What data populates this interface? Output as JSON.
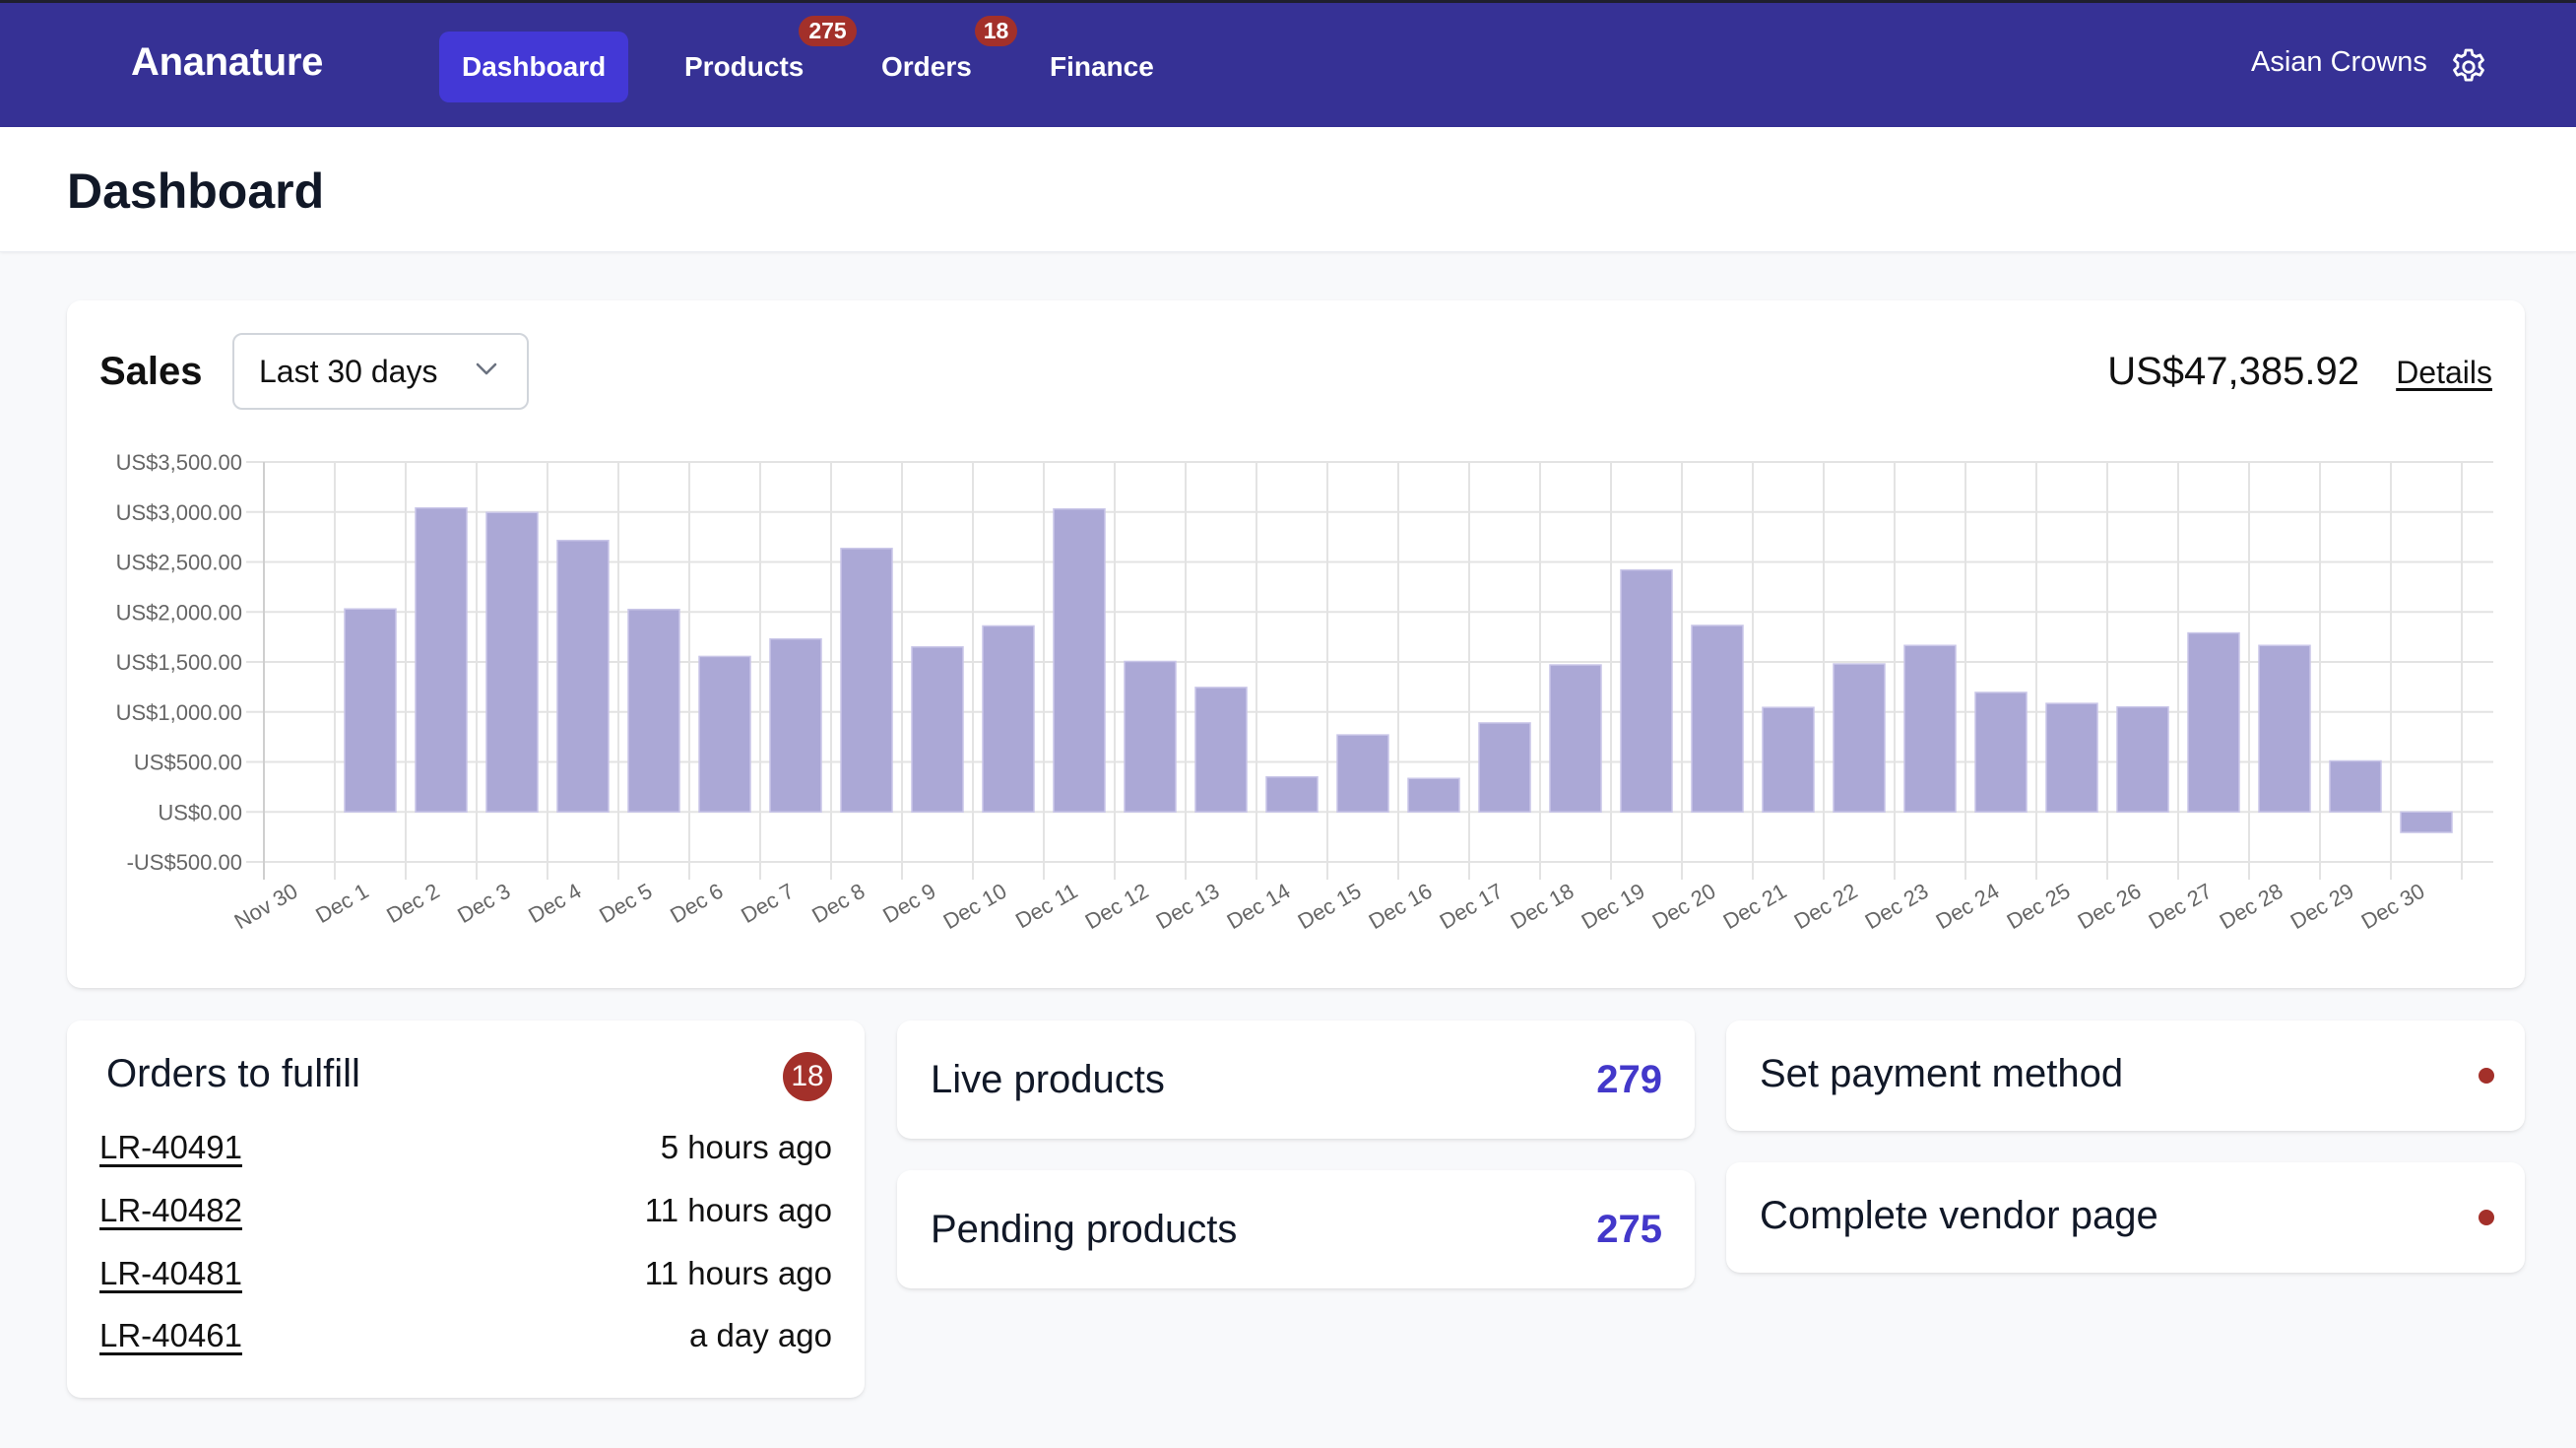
{
  "header": {
    "logo": "Ananature",
    "nav": [
      {
        "label": "Dashboard",
        "active": true
      },
      {
        "label": "Products",
        "badge": "275"
      },
      {
        "label": "Orders",
        "badge": "18"
      },
      {
        "label": "Finance"
      }
    ],
    "account_name": "Asian Crowns",
    "settings_icon": "gear-icon"
  },
  "page": {
    "title": "Dashboard"
  },
  "sales": {
    "label": "Sales",
    "range": "Last 30 days",
    "total": "US$47,385.92",
    "details_label": "Details"
  },
  "chart_data": {
    "type": "bar",
    "title": "Sales",
    "xlabel": "",
    "ylabel": "",
    "ylim": [
      -500,
      3500
    ],
    "yticks": [
      -500,
      0,
      500,
      1000,
      1500,
      2000,
      2500,
      3000,
      3500
    ],
    "ytick_labels": [
      "-US$500.00",
      "US$0.00",
      "US$500.00",
      "US$1,000.00",
      "US$1,500.00",
      "US$2,000.00",
      "US$2,500.00",
      "US$3,000.00",
      "US$3,500.00"
    ],
    "grid": true,
    "legend": "none",
    "bar_color": "#aba8d6",
    "categories": [
      "Nov 30",
      "Dec 1",
      "Dec 2",
      "Dec 3",
      "Dec 4",
      "Dec 5",
      "Dec 6",
      "Dec 7",
      "Dec 8",
      "Dec 9",
      "Dec 10",
      "Dec 11",
      "Dec 12",
      "Dec 13",
      "Dec 14",
      "Dec 15",
      "Dec 16",
      "Dec 17",
      "Dec 18",
      "Dec 19",
      "Dec 20",
      "Dec 21",
      "Dec 22",
      "Dec 23",
      "Dec 24",
      "Dec 25",
      "Dec 26",
      "Dec 27",
      "Dec 28",
      "Dec 29",
      "Dec 30"
    ],
    "values": [
      null,
      2030,
      3040,
      2995,
      2715,
      2025,
      1555,
      1730,
      2635,
      1650,
      1860,
      3030,
      1505,
      1245,
      350,
      770,
      335,
      890,
      1470,
      2420,
      1865,
      1045,
      1480,
      1665,
      1195,
      1085,
      1050,
      1790,
      1665,
      510,
      -205
    ]
  },
  "orders": {
    "title": "Orders to fulfill",
    "count": "18",
    "items": [
      {
        "id": "LR-40491",
        "time": "5 hours ago"
      },
      {
        "id": "LR-40482",
        "time": "11 hours ago"
      },
      {
        "id": "LR-40481",
        "time": "11 hours ago"
      },
      {
        "id": "LR-40461",
        "time": "a day ago"
      }
    ]
  },
  "stats": [
    {
      "label": "Live products",
      "value": "279"
    },
    {
      "label": "Pending products",
      "value": "275"
    }
  ],
  "todos": [
    {
      "label": "Set payment method",
      "status": "incomplete"
    },
    {
      "label": "Complete vendor page",
      "status": "incomplete"
    }
  ],
  "colors": {
    "header_bg": "#363195",
    "nav_active": "#4338d6",
    "badge": "#a3302a",
    "accent": "#4338ca",
    "bar": "#aba8d6"
  }
}
